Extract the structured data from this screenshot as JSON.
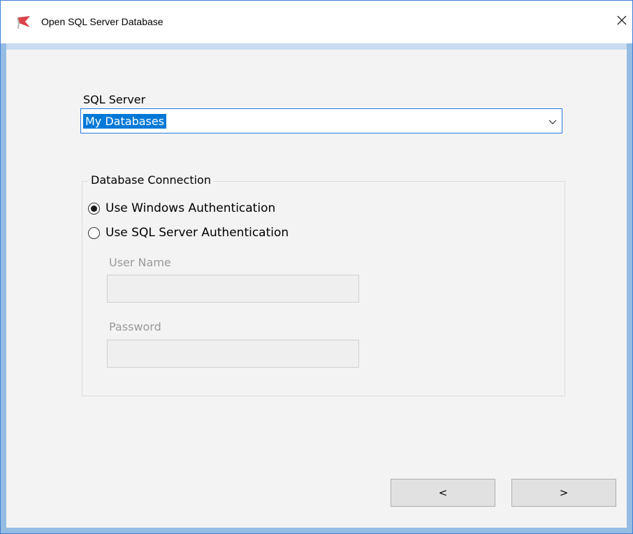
{
  "window": {
    "title": "Open SQL Server Database",
    "app_icon": "red-flag-icon",
    "close_icon": "close-icon"
  },
  "form": {
    "sql_server_label": "SQL Server",
    "sql_server_value": "My Databases",
    "dropdown_icon": "chevron-down-icon"
  },
  "connection": {
    "group_title": "Database Connection",
    "windows_auth_label": "Use Windows Authentication",
    "windows_auth_selected": true,
    "sql_auth_label": "Use SQL Server Authentication",
    "sql_auth_selected": false,
    "user_name_label": "User Name",
    "user_name_value": "",
    "password_label": "Password",
    "password_value": ""
  },
  "nav": {
    "back_label": "<",
    "next_label": ">"
  },
  "colors": {
    "selection": "#0078d7",
    "frame": "#95bce3",
    "client_bg": "#f3f3f3"
  }
}
